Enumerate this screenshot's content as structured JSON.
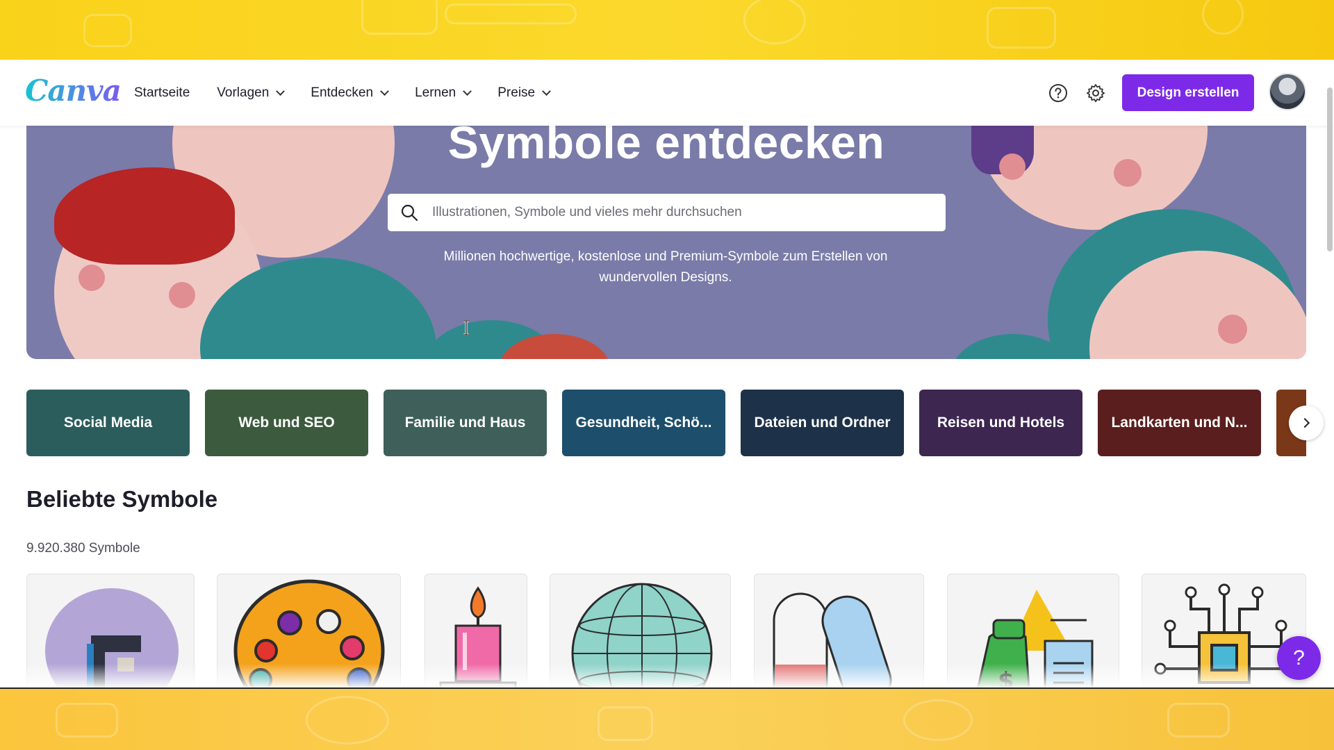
{
  "header": {
    "logo": "Canva",
    "nav": [
      {
        "label": "Startseite",
        "dropdown": false
      },
      {
        "label": "Vorlagen",
        "dropdown": true
      },
      {
        "label": "Entdecken",
        "dropdown": true
      },
      {
        "label": "Lernen",
        "dropdown": true
      },
      {
        "label": "Preise",
        "dropdown": true
      }
    ],
    "help_icon": "help-circle-icon",
    "settings_icon": "gear-icon",
    "create_button": "Design erstellen"
  },
  "hero": {
    "title": "Symbole entdecken",
    "search_placeholder": "Illustrationen, Symbole und vieles mehr durchsuchen",
    "subtitle": "Millionen hochwertige, kostenlose und Premium-Symbole zum Erstellen von wundervollen Designs."
  },
  "categories": [
    {
      "label": "Social Media",
      "color": "#2b5d5c"
    },
    {
      "label": "Web und SEO",
      "color": "#3c5a3d"
    },
    {
      "label": "Familie und Haus",
      "color": "#3e5f5a"
    },
    {
      "label": "Gesundheit, Schö...",
      "color": "#1d4e6b"
    },
    {
      "label": "Dateien und Ordner",
      "color": "#1d3148"
    },
    {
      "label": "Reisen und Hotels",
      "color": "#3d2650"
    },
    {
      "label": "Landkarten und N...",
      "color": "#5a1e1e"
    },
    {
      "label": "",
      "color": "#7a3818"
    }
  ],
  "popular": {
    "title": "Beliebte Symbole",
    "count": "9.920.380 Symbole",
    "items": [
      {
        "name": "coffee-machine-icon"
      },
      {
        "name": "paint-palette-icon"
      },
      {
        "name": "candle-icon"
      },
      {
        "name": "globe-icon"
      },
      {
        "name": "pills-icon"
      },
      {
        "name": "money-bag-documents-icon"
      },
      {
        "name": "circuit-chip-icon"
      }
    ]
  },
  "help_fab": "?"
}
